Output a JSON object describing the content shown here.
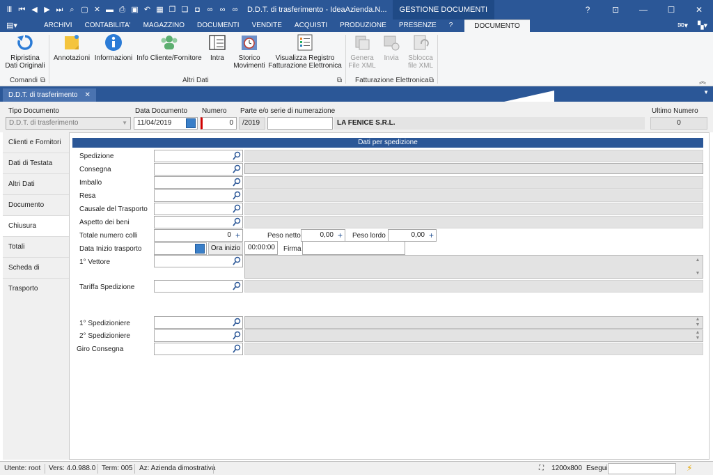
{
  "titlebar": {
    "title": "D.D.T. di trasferimento - IdeaAzienda.N...",
    "module": "GESTIONE DOCUMENTI",
    "help": "?"
  },
  "menu": {
    "tabs": [
      "ARCHIVI",
      "CONTABILITA'",
      "MAGAZZINO",
      "DOCUMENTI",
      "VENDITE",
      "ACQUISTI",
      "PRODUZIONE",
      "PRESENZE",
      "?",
      "DOCUMENTO"
    ],
    "active": "DOCUMENTO"
  },
  "ribbon": {
    "comandi": {
      "label": "Comandi",
      "ripristina": "Ripristina\nDati Originali"
    },
    "altri": {
      "label": "Altri Dati",
      "annotazioni": "Annotazioni",
      "informazioni": "Informazioni",
      "info_cliente": "Info Cliente/Fornitore",
      "intra": "Intra",
      "storico": "Storico\nMovimenti",
      "visualizza": "Visualizza Registro\nFatturazione Elettronica"
    },
    "fattura": {
      "label": "Fatturazione Elettronica",
      "genera": "Genera\nFile XML",
      "invia": "Invia",
      "sblocca": "Sblocca\nfile XML"
    }
  },
  "doctab": {
    "label": "D.D.T. di trasferimento",
    "close": "✕"
  },
  "header": {
    "tipo_label": "Tipo Documento",
    "tipo_value": "D.D.T. di trasferimento",
    "data_label": "Data Documento",
    "data_value": "11/04/2019",
    "numero_label": "Numero",
    "numero_value": "0",
    "parte_label": "Parte e/o serie di numerazione",
    "parte_value": "/2019",
    "parte_extra": "",
    "ragione": "LA FENICE S.R.L.",
    "ultimo_label": "Ultimo Numero",
    "ultimo_value": "0"
  },
  "sidenav": [
    "Clienti e Fornitori",
    "Dati di Testata",
    "Altri Dati",
    "Documento",
    "Chiusura",
    "Totali",
    "Scheda di Trasporto"
  ],
  "sidenav_active": "Chiusura",
  "panel": {
    "title": "Dati per spedizione",
    "spedizione": "Spedizione",
    "consegna": "Consegna",
    "imballo": "Imballo",
    "resa": "Resa",
    "causale": "Causale del Trasporto",
    "aspetto": "Aspetto dei beni",
    "colli_label": "Totale numero colli",
    "colli_value": "0",
    "peso_netto_label": "Peso netto",
    "peso_netto_value": "0,00",
    "peso_lordo_label": "Peso lordo",
    "peso_lordo_value": "0,00",
    "data_inizio_label": "Data Inizio trasporto",
    "ora_inizio_label": "Ora inizio",
    "ora_inizio_value": "00:00:00",
    "firma_label": "Firma",
    "vettore": "1° Vettore",
    "tariffa": "Tariffa Spedizione",
    "spedizioniere1": "1° Spedizioniere",
    "spedizioniere2": "2° Spedizioniere",
    "giro": "Giro Consegna"
  },
  "status": {
    "utente": "Utente: root",
    "vers": "Vers: 4.0.988.0",
    "term": "Term: 005",
    "az": "Az: Azienda dimostrativa",
    "res": "1200x800",
    "esegui": "Esegui"
  },
  "colors": {
    "accent": "#2b5797",
    "accent_dark": "#1f4a86"
  }
}
